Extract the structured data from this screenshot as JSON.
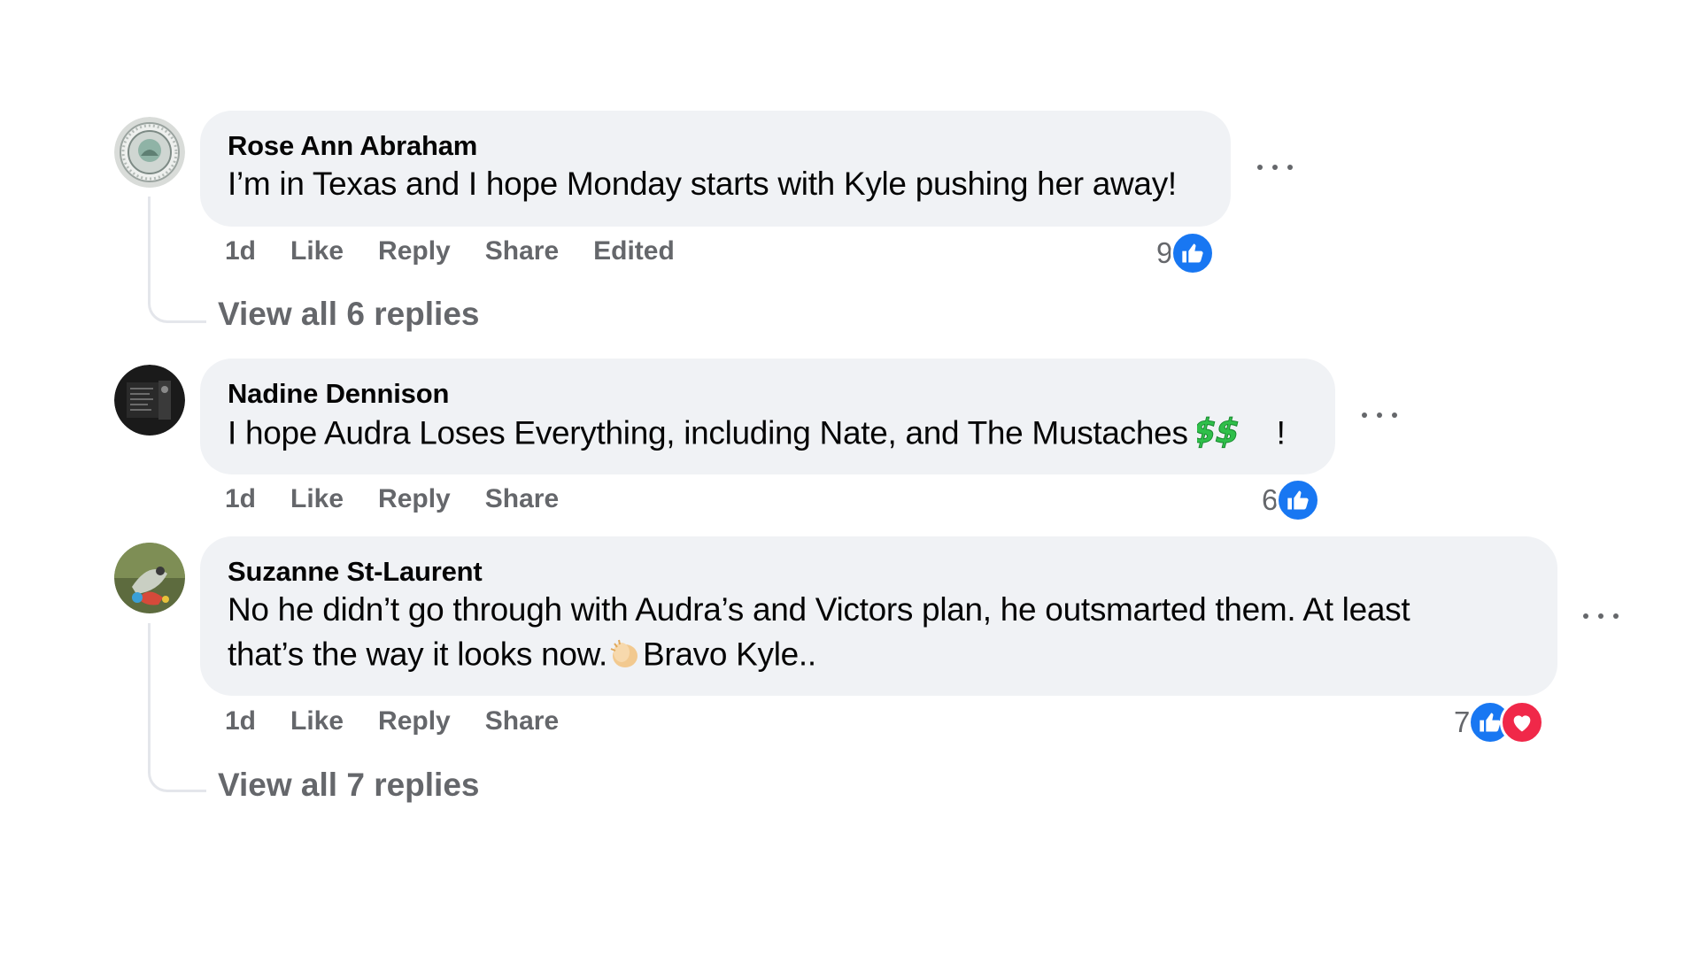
{
  "comments": [
    {
      "author": "Rose Ann Abraham",
      "text": "I’m in Texas and I hope Monday starts with Kyle pushing her away!",
      "time": "1d",
      "like_label": "Like",
      "reply_label": "Reply",
      "share_label": "Share",
      "edited_label": "Edited",
      "reaction_count": "9",
      "reactions": [
        "like-icon"
      ],
      "view_replies": "View all 6 replies",
      "avatar": "seal-avatar"
    },
    {
      "author": "Nadine Dennison",
      "text": "I hope Audra Loses Everything, including Nate, and The Mustaches ",
      "text_suffix": "!",
      "emoji": "money-emoji",
      "time": "1d",
      "like_label": "Like",
      "reply_label": "Reply",
      "share_label": "Share",
      "reaction_count": "6",
      "reactions": [
        "like-icon"
      ],
      "avatar": "dark-photo-avatar"
    },
    {
      "author": "Suzanne St-Laurent",
      "text_line1": "No he didn’t go through with Audra’s and Victors plan, he outsmarted them. At least",
      "text_line2_a": "that’s the way it looks now.",
      "text_line2_b": "Bravo Kyle..",
      "emoji": "clapping-hands-emoji",
      "time": "1d",
      "like_label": "Like",
      "reply_label": "Reply",
      "share_label": "Share",
      "reaction_count": "7",
      "reactions": [
        "like-icon",
        "love-icon"
      ],
      "view_replies": "View all 7 replies",
      "avatar": "bird-photo-avatar"
    }
  ],
  "colors": {
    "bubble": "#f0f2f5",
    "secondary_text": "#65676b",
    "like_blue": "#1877f2",
    "love_red": "#f02849",
    "thread_line": "#e4e6eb"
  }
}
